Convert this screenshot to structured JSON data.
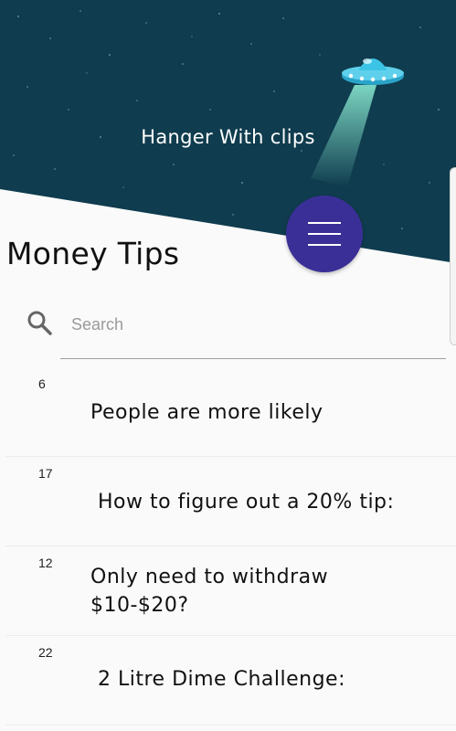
{
  "header": {
    "title": "Hanger With clips"
  },
  "page_title": "Money Tips",
  "search": {
    "placeholder": "Search",
    "value": ""
  },
  "tips": [
    {
      "count": "6",
      "title": "People are more likely"
    },
    {
      "count": "17",
      "title": "How to figure out a 20% tip:"
    },
    {
      "count": "12",
      "title": "Only need to withdraw $10-$20?"
    },
    {
      "count": "22",
      "title": "2 Litre Dime Challenge:"
    }
  ],
  "colors": {
    "header_bg": "#0f3c4e",
    "fab_bg": "#3a2f97",
    "page_bg": "#fafafa"
  }
}
